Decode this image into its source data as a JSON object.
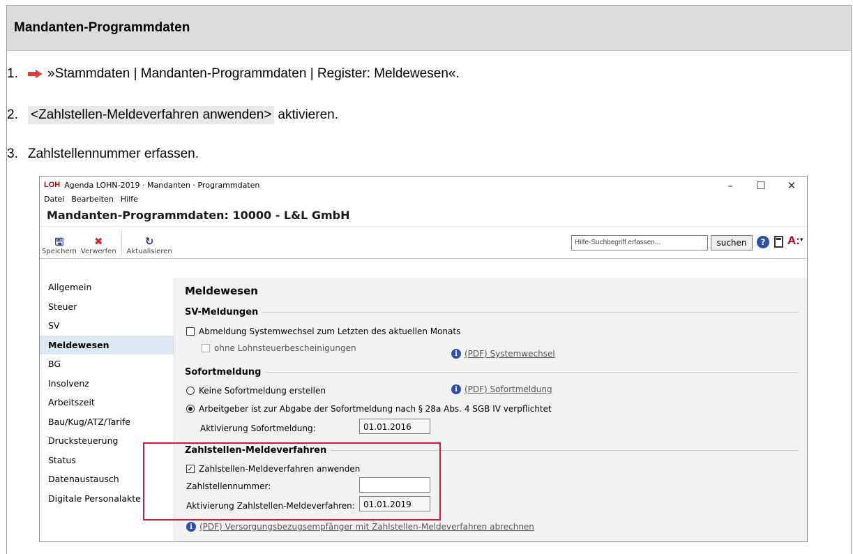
{
  "doc": {
    "heading": "Mandanten-Programmdaten",
    "steps": [
      {
        "num": "1.",
        "text": "»Stammdaten | Mandanten-Programmdaten | Register: Meldewesen«."
      },
      {
        "num": "2.",
        "highlight": "<Zahlstellen-Meldeverfahren anwenden>",
        "text": "aktivieren."
      },
      {
        "num": "3.",
        "text": "Zahlstellennummer erfassen."
      }
    ]
  },
  "window": {
    "logo": "LOH",
    "title": "Agenda LOHN-2019 · Mandanten · Programmdaten",
    "controls": {
      "minimize": "–",
      "maximize": "☐",
      "close": "✕"
    },
    "menu": [
      "Datei",
      "Bearbeiten",
      "Hilfe"
    ],
    "page_title": "Mandanten-Programmdaten: 10000 - L&L GmbH",
    "toolbar": {
      "save": "Speichern",
      "discard": "Verwerfen",
      "refresh": "Aktualisieren",
      "search_placeholder": "Hilfe-Suchbegriff erfassen...",
      "search_button": "suchen",
      "help": "?",
      "a_label": "A:",
      "a_dropdown": "▾"
    },
    "sidebar": [
      {
        "label": "Allgemein",
        "active": false
      },
      {
        "label": "Steuer",
        "active": false
      },
      {
        "label": "SV",
        "active": false
      },
      {
        "label": "Meldewesen",
        "active": true
      },
      {
        "label": "BG",
        "active": false
      },
      {
        "label": "Insolvenz",
        "active": false
      },
      {
        "label": "Arbeitszeit",
        "active": false
      },
      {
        "label": "Bau/Kug/ATZ/Tarife",
        "active": false
      },
      {
        "label": "Drucksteuerung",
        "active": false
      },
      {
        "label": "Status",
        "active": false
      },
      {
        "label": "Datenaustausch",
        "active": false
      },
      {
        "label": "Digitale Personalakte",
        "active": false
      }
    ],
    "content": {
      "heading": "Meldewesen",
      "sv_group": "SV-Meldungen",
      "sv_abmeldung": "Abmeldung Systemwechsel zum Letzten des aktuellen Monats",
      "sv_ohne_lst": "ohne Lohnsteuerbescheinigungen",
      "sv_pdf": "(PDF) Systemwechsel",
      "sofort_group": "Sofortmeldung",
      "sofort_keine": "Keine Sofortmeldung erstellen",
      "sofort_pdf": "(PDF) Sofortmeldung",
      "sofort_ag": "Arbeitgeber ist zur Abgabe der Sofortmeldung nach § 28a Abs. 4 SGB IV verpflichtet",
      "sofort_aktivierung_label": "Aktivierung Sofortmeldung:",
      "sofort_aktivierung_value": "01.01.2016",
      "zahl_group": "Zahlstellen-Meldeverfahren",
      "zahl_anwenden": "Zahlstellen-Meldeverfahren anwenden",
      "zahl_nummer_label": "Zahlstellennummer:",
      "zahl_nummer_value": "",
      "zahl_aktivierung_label": "Aktivierung Zahlstellen-Meldeverfahren:",
      "zahl_aktivierung_value": "01.01.2019",
      "zahl_pdf": "(PDF) Versorgungsbezugsempfänger mit Zahlstellen-Meldeverfahren abrechnen",
      "check_mark": "✓"
    }
  },
  "colors": {
    "accent_red": "#d0193f",
    "brand_red": "#b00018",
    "info_blue": "#2e4fa6",
    "active_bg": "#dde8f5"
  }
}
